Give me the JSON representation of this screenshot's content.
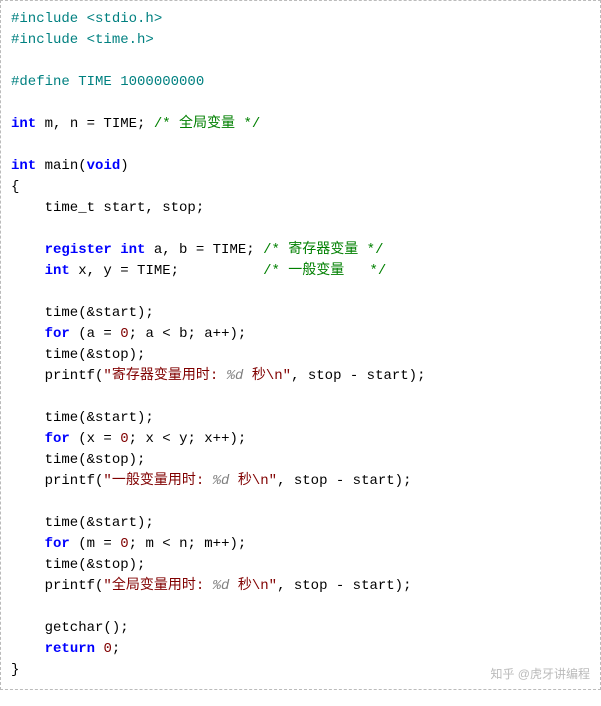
{
  "code": {
    "l1_a": "#include <stdio.h>",
    "l2_a": "#include <time.h>",
    "blank1": "",
    "l4_a": "#define TIME 1000000000",
    "blank2": "",
    "l6_kw": "int",
    "l6_rest": " m, n = TIME; ",
    "l6_cm": "/* 全局变量 */",
    "blank3": "",
    "l8_kw1": "int",
    "l8_mid": " main(",
    "l8_kw2": "void",
    "l8_end": ")",
    "l9": "{",
    "l10": "    time_t start, stop;",
    "blank4": "",
    "l12_pre": "    ",
    "l12_kw": "register int",
    "l12_rest": " a, b = TIME; ",
    "l12_cm": "/* 寄存器变量 */",
    "l13_pre": "    ",
    "l13_kw": "int",
    "l13_rest": " x, y = TIME;          ",
    "l13_cm": "/* 一般变量   */",
    "blank5": "",
    "l15": "    time(&start);",
    "l16_pre": "    ",
    "l16_kw": "for",
    "l16_rest": " (a = ",
    "l16_num": "0",
    "l16_rest2": "; a < b; a++);",
    "l17": "    time(&stop);",
    "l18_pre": "    printf(",
    "l18_s1": "\"寄存器变量用时: ",
    "l18_fmt": "%d",
    "l18_s2": " 秒\\n\"",
    "l18_end": ", stop - start);",
    "blank6": "",
    "l20": "    time(&start);",
    "l21_pre": "    ",
    "l21_kw": "for",
    "l21_rest": " (x = ",
    "l21_num": "0",
    "l21_rest2": "; x < y; x++);",
    "l22": "    time(&stop);",
    "l23_pre": "    printf(",
    "l23_s1": "\"一般变量用时: ",
    "l23_fmt": "%d",
    "l23_s2": " 秒\\n\"",
    "l23_end": ", stop - start);",
    "blank7": "",
    "l25": "    time(&start);",
    "l26_pre": "    ",
    "l26_kw": "for",
    "l26_rest": " (m = ",
    "l26_num": "0",
    "l26_rest2": "; m < n; m++);",
    "l27": "    time(&stop);",
    "l28_pre": "    printf(",
    "l28_s1": "\"全局变量用时: ",
    "l28_fmt": "%d",
    "l28_s2": " 秒\\n\"",
    "l28_end": ", stop - start);",
    "blank8": "",
    "l30": "    getchar();",
    "l31_pre": "    ",
    "l31_kw": "return",
    "l31_rest": " ",
    "l31_num": "0",
    "l31_end": ";",
    "l32": "}"
  },
  "watermark": "知乎 @虎牙讲编程"
}
